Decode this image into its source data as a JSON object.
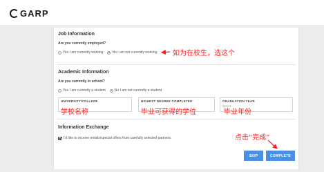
{
  "logo": {
    "text": "GARP"
  },
  "job": {
    "title": "Job Information",
    "question": "Are you currently employed?",
    "options": [
      {
        "label": "Yes I am currently working",
        "selected": false
      },
      {
        "label": "No I am not currently working",
        "selected": true
      }
    ]
  },
  "academic": {
    "title": "Academic Information",
    "question": "Are you currently in school?",
    "options": [
      {
        "label": "Yes I am currently a student",
        "selected": false
      },
      {
        "label": "No I am not currently a student",
        "selected": true
      }
    ],
    "fields": [
      {
        "label": "UNIVERSITY/COLLEGE",
        "value": ""
      },
      {
        "label": "HIGHEST DEGREE COMPLETED",
        "value": ""
      },
      {
        "label": "GRADUATION YEAR",
        "value": "Select"
      }
    ]
  },
  "exchange": {
    "title": "Information Exchange",
    "consent_label": "I'd like to receive emails/special offers from carefully selected partners.",
    "consent_checked": true
  },
  "buttons": {
    "skip": "SKIP",
    "complete": "COMPLETE"
  },
  "annotations": {
    "student_note": "如为在校生，选这个",
    "university_note": "学校名称",
    "degree_note": "毕业可获得的学位",
    "year_note": "毕业年份",
    "complete_note": "点击“完成”"
  },
  "colors": {
    "accent": "#4a90e2",
    "annotation": "#ff1f1f"
  }
}
